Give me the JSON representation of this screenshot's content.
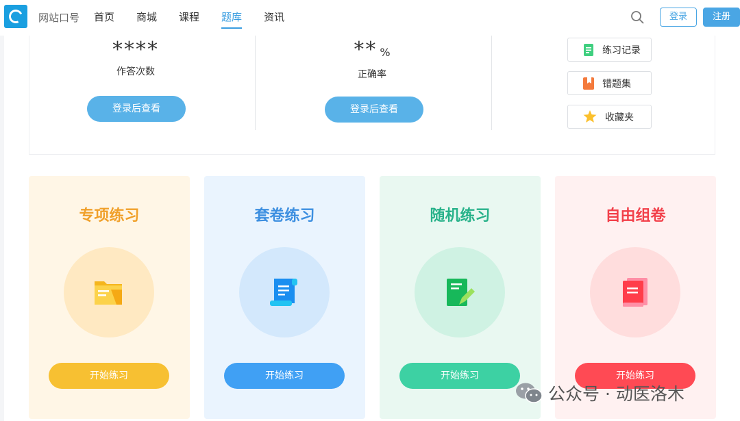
{
  "header": {
    "site_name": "网站口号",
    "nav": [
      "首页",
      "商城",
      "课程",
      "题库",
      "资讯"
    ],
    "active_nav": "题库",
    "login_label": "登录",
    "register_label": "注册"
  },
  "stats": {
    "answers": {
      "value": "****",
      "label": "作答次数",
      "button": "登录后查看"
    },
    "accuracy": {
      "value": "**",
      "unit": "%",
      "label": "正确率",
      "button": "登录后查看"
    },
    "links": [
      "练习记录",
      "错题集",
      "收藏夹"
    ]
  },
  "cards": [
    {
      "title": "专项练习",
      "button": "开始练习",
      "icon": "folder-icon",
      "title_color": "#f0a02a",
      "bg": "#fff6e6",
      "circle": "#ffe9c2",
      "btn_color": "#f7c032"
    },
    {
      "title": "套卷练习",
      "button": "开始练习",
      "icon": "scroll-icon",
      "title_color": "#3d8fe0",
      "bg": "#eaf4fe",
      "circle": "#d3e8fc",
      "btn_color": "#40a0f4"
    },
    {
      "title": "随机练习",
      "button": "开始练习",
      "icon": "note-edit-icon",
      "title_color": "#28b28a",
      "bg": "#e9f8f1",
      "circle": "#cff2e3",
      "btn_color": "#3dd1a3"
    },
    {
      "title": "自由组卷",
      "button": "开始练习",
      "icon": "book-icon",
      "title_color": "#f2404a",
      "bg": "#fff1f1",
      "circle": "#ffdddd",
      "btn_color": "#ff4a54"
    }
  ],
  "watermark": "公众号 · 动医洛木",
  "colors": {
    "accent": "#4aa6e4",
    "logo": "#1a9fe0"
  }
}
